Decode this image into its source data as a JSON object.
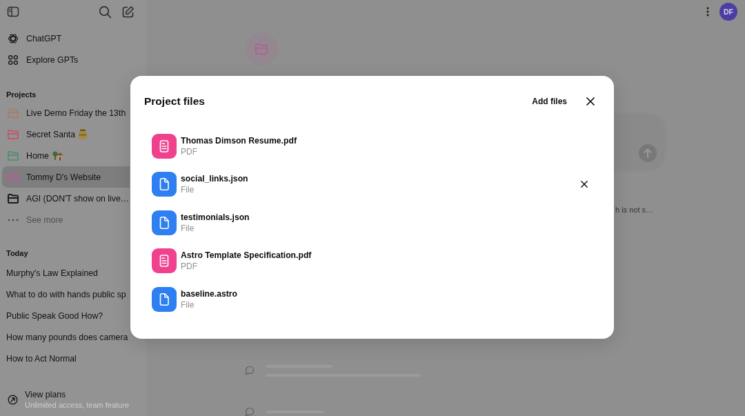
{
  "sidebar": {
    "nav": [
      {
        "label": "ChatGPT",
        "kind": "logo"
      },
      {
        "label": "Explore GPTs",
        "kind": "grid"
      }
    ],
    "projects_heading": "Projects",
    "projects": [
      {
        "label": "Live Demo Friday the 13th",
        "kind": "plain",
        "color": "#a3806c",
        "selected": false
      },
      {
        "label": "Secret Santa",
        "kind": "jar",
        "color": "#bc5c6a",
        "selected": false
      },
      {
        "label": "Home",
        "kind": "house",
        "color": "#558e70",
        "selected": false
      },
      {
        "label": "Tommy D's Website",
        "kind": "plain",
        "color": "#b0619a",
        "selected": true
      },
      {
        "label": "AGI (DON'T show on live…",
        "kind": "plain",
        "color": "#1a1a1a",
        "selected": false
      }
    ],
    "see_more": "See more",
    "chats_heading": "Today",
    "chats": [
      {
        "title": "Murphy's Law Explained",
        "selected": false
      },
      {
        "title": "What to do with hands public sp",
        "selected": false
      },
      {
        "title": "Public Speak Good How?",
        "selected": false
      },
      {
        "title": "How many pounds does camera",
        "selected": false
      },
      {
        "title": "How to Act Normal",
        "selected": false
      }
    ],
    "plan": {
      "title": "View plans",
      "subtitle": "Unlimited access, team feature"
    }
  },
  "header": {
    "avatar_initials": "DF"
  },
  "project": {
    "text_fragment": "h is not s…"
  },
  "modal": {
    "title": "Project files",
    "add_button": "Add files",
    "files": [
      {
        "name": "Thomas Dimson Resume.pdf",
        "type_label": "PDF",
        "kind": "pdf",
        "hovered": false
      },
      {
        "name": "social_links.json",
        "type_label": "File",
        "kind": "file",
        "hovered": true
      },
      {
        "name": "testimonials.json",
        "type_label": "File",
        "kind": "file",
        "hovered": false
      },
      {
        "name": "Astro Template Specification.pdf",
        "type_label": "PDF",
        "kind": "pdf",
        "hovered": false
      },
      {
        "name": "baseline.astro",
        "type_label": "File",
        "kind": "file",
        "hovered": false
      }
    ]
  }
}
